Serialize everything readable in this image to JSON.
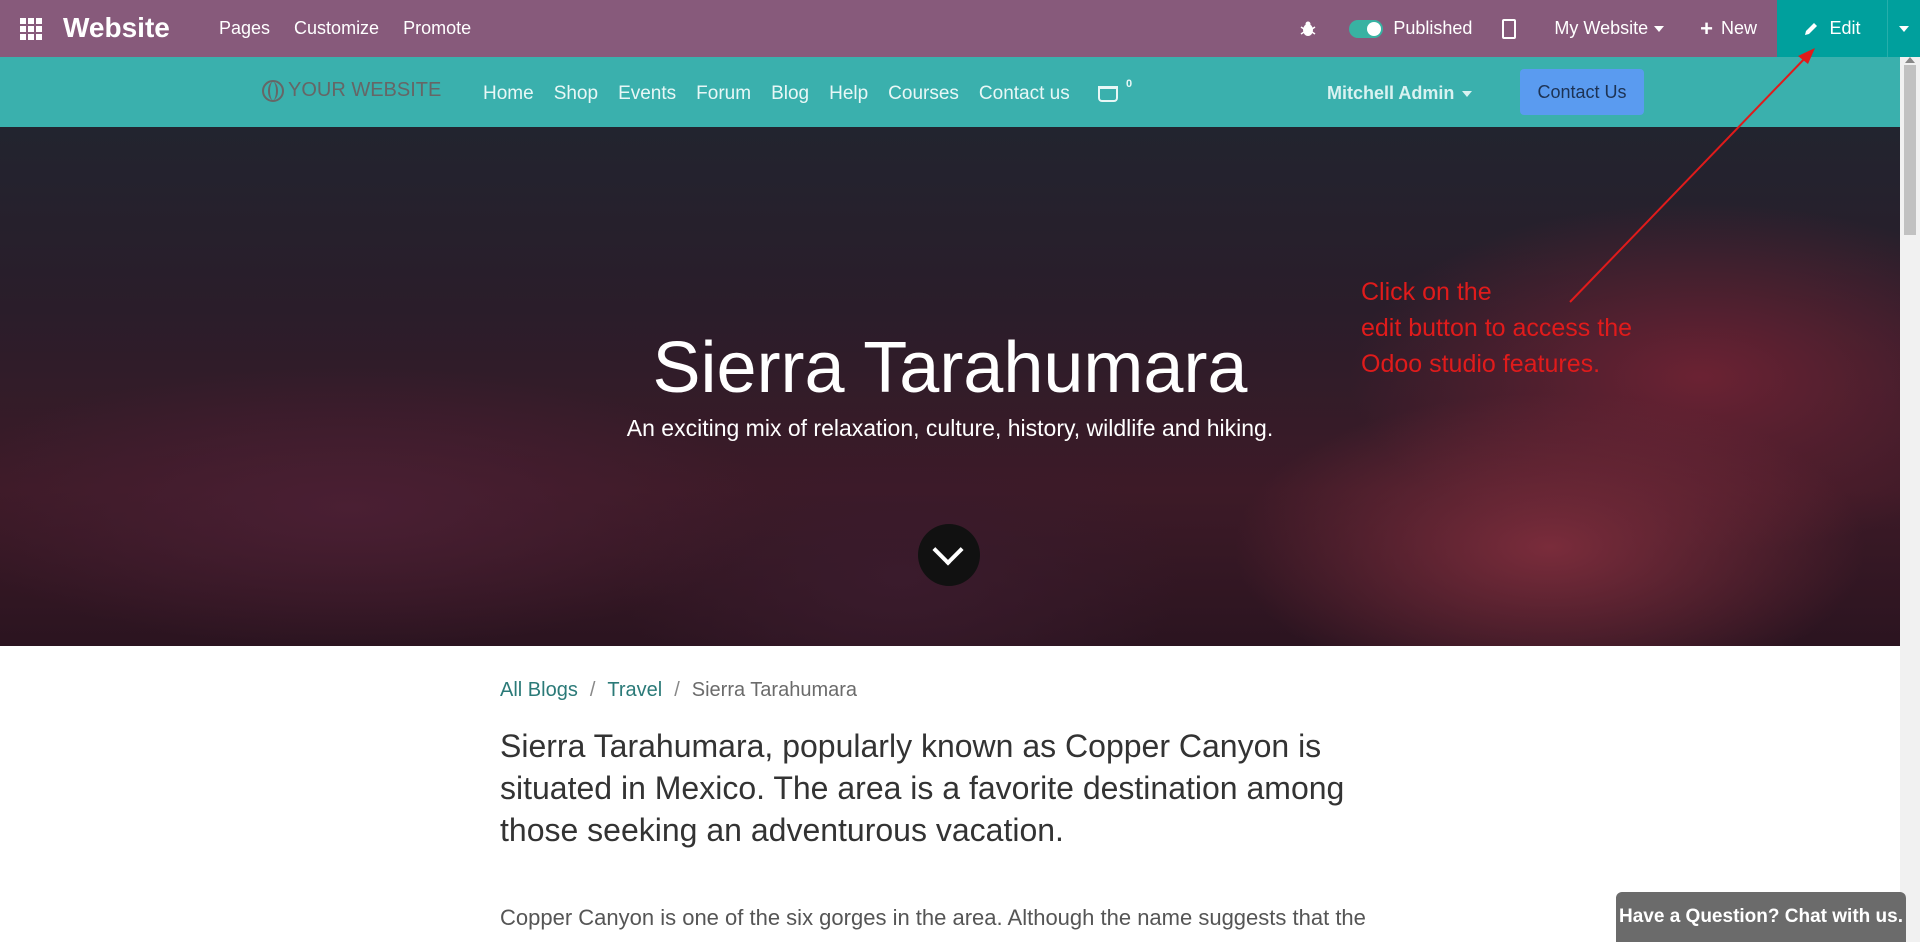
{
  "topbar": {
    "brand": "Website",
    "menu": [
      "Pages",
      "Customize",
      "Promote"
    ],
    "published_label": "Published",
    "site_selector": "My Website",
    "new_label": "New",
    "edit_label": "Edit",
    "bg_color": "#875a7b",
    "edit_color": "#00a09d"
  },
  "site_nav": {
    "logo_text": "YOUR WEBSITE",
    "links": [
      "Home",
      "Shop",
      "Events",
      "Forum",
      "Blog",
      "Help",
      "Courses",
      "Contact us"
    ],
    "cart_count": "0",
    "user_name": "Mitchell Admin",
    "contact_button": "Contact Us",
    "bg_color": "#3ab0ad"
  },
  "hero": {
    "title": "Sierra Tarahumara",
    "subtitle": "An exciting mix of relaxation, culture, history, wildlife and hiking."
  },
  "annotation": {
    "text": "Click on the\nedit button to access the\nOdoo studio features.",
    "color": "#e01b1b"
  },
  "breadcrumb": {
    "all_blogs": "All Blogs",
    "sep": "/",
    "category": "Travel",
    "current": "Sierra Tarahumara"
  },
  "article": {
    "lead": "Sierra Tarahumara, popularly known as Copper Canyon is situated in Mexico. The area is a favorite destination among those seeking an adventurous vacation.",
    "body": "Copper Canyon is one of the six gorges in the area. Although the name suggests that the"
  },
  "chat": {
    "label": "Have a Question? Chat with us."
  }
}
